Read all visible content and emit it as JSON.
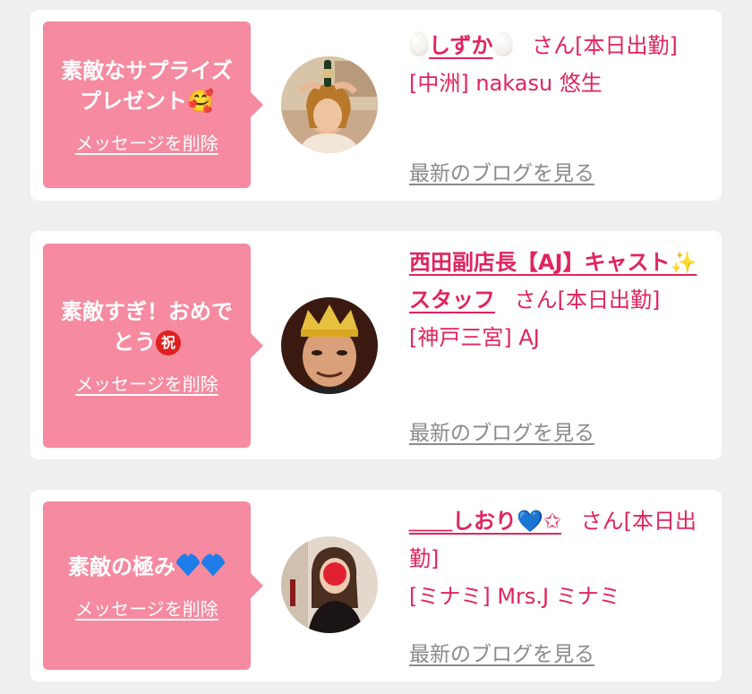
{
  "cards": [
    {
      "message": "素敵なサプライズプレゼント",
      "message_emoji": "smiling-face-with-hearts",
      "delete_label": "メッセージを削除",
      "name_prefix_icon": "egg-icon",
      "name": "しずか",
      "name_suffix_icon": "egg-icon",
      "san_status": "さん[本日出勤]",
      "shop": "[中洲] nakasu 悠生",
      "blog_label": "最新のブログを見る"
    },
    {
      "message": "素敵すぎ！おめでとう",
      "message_emoji": "congratulations-icon",
      "iwai_char": "祝",
      "delete_label": "メッセージを削除",
      "name": "西田副店長【AJ】キャスト✨スタッフ",
      "san_status": "さん[本日出勤]",
      "shop": "[神戸三宮] AJ",
      "blog_label": "最新のブログを見る"
    },
    {
      "message": "素敵の極み",
      "message_emoji": "blue-heart-icon",
      "delete_label": "メッセージを削除",
      "name": "＿＿しおり💙✩",
      "san_status": "さん[本日出勤]",
      "shop": "[ミナミ] Mrs.J ミナミ",
      "blog_label": "最新のブログを見る"
    }
  ],
  "colors": {
    "bubble": "#f58aa0",
    "accent": "#e0245e",
    "link_gray": "#8a8a8a",
    "background": "#efefef"
  }
}
